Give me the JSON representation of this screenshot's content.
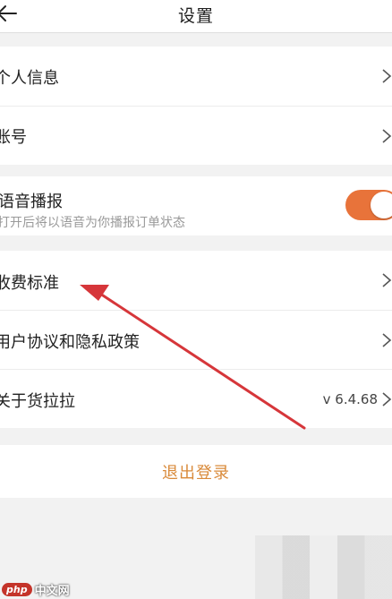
{
  "header": {
    "title": "设置",
    "back_icon": "arrow-left-icon"
  },
  "groups": [
    {
      "items": [
        {
          "label": "个人信息",
          "trailing": "chevron-right-icon"
        },
        {
          "label": "账号",
          "trailing": "chevron-right-icon"
        }
      ]
    },
    {
      "items": [
        {
          "label": "语音播报",
          "subtitle": "打开后将以语音为你播报订单状态",
          "toggle_on": true
        }
      ]
    },
    {
      "items": [
        {
          "label": "收费标准",
          "trailing": "chevron-right-icon"
        },
        {
          "label": "用户协议和隐私政策",
          "trailing": "chevron-right-icon"
        },
        {
          "label": "关于货拉拉",
          "value": "v 6.4.68",
          "trailing": "chevron-right-icon"
        }
      ]
    }
  ],
  "logout_label": "退出登录",
  "watermark": {
    "badge": "php",
    "text": "中文网"
  },
  "colors": {
    "accent": "#e8733a",
    "logout_text": "#d98a3a",
    "annotation_arrow": "#d6363a",
    "background": "#f2f2f2"
  }
}
